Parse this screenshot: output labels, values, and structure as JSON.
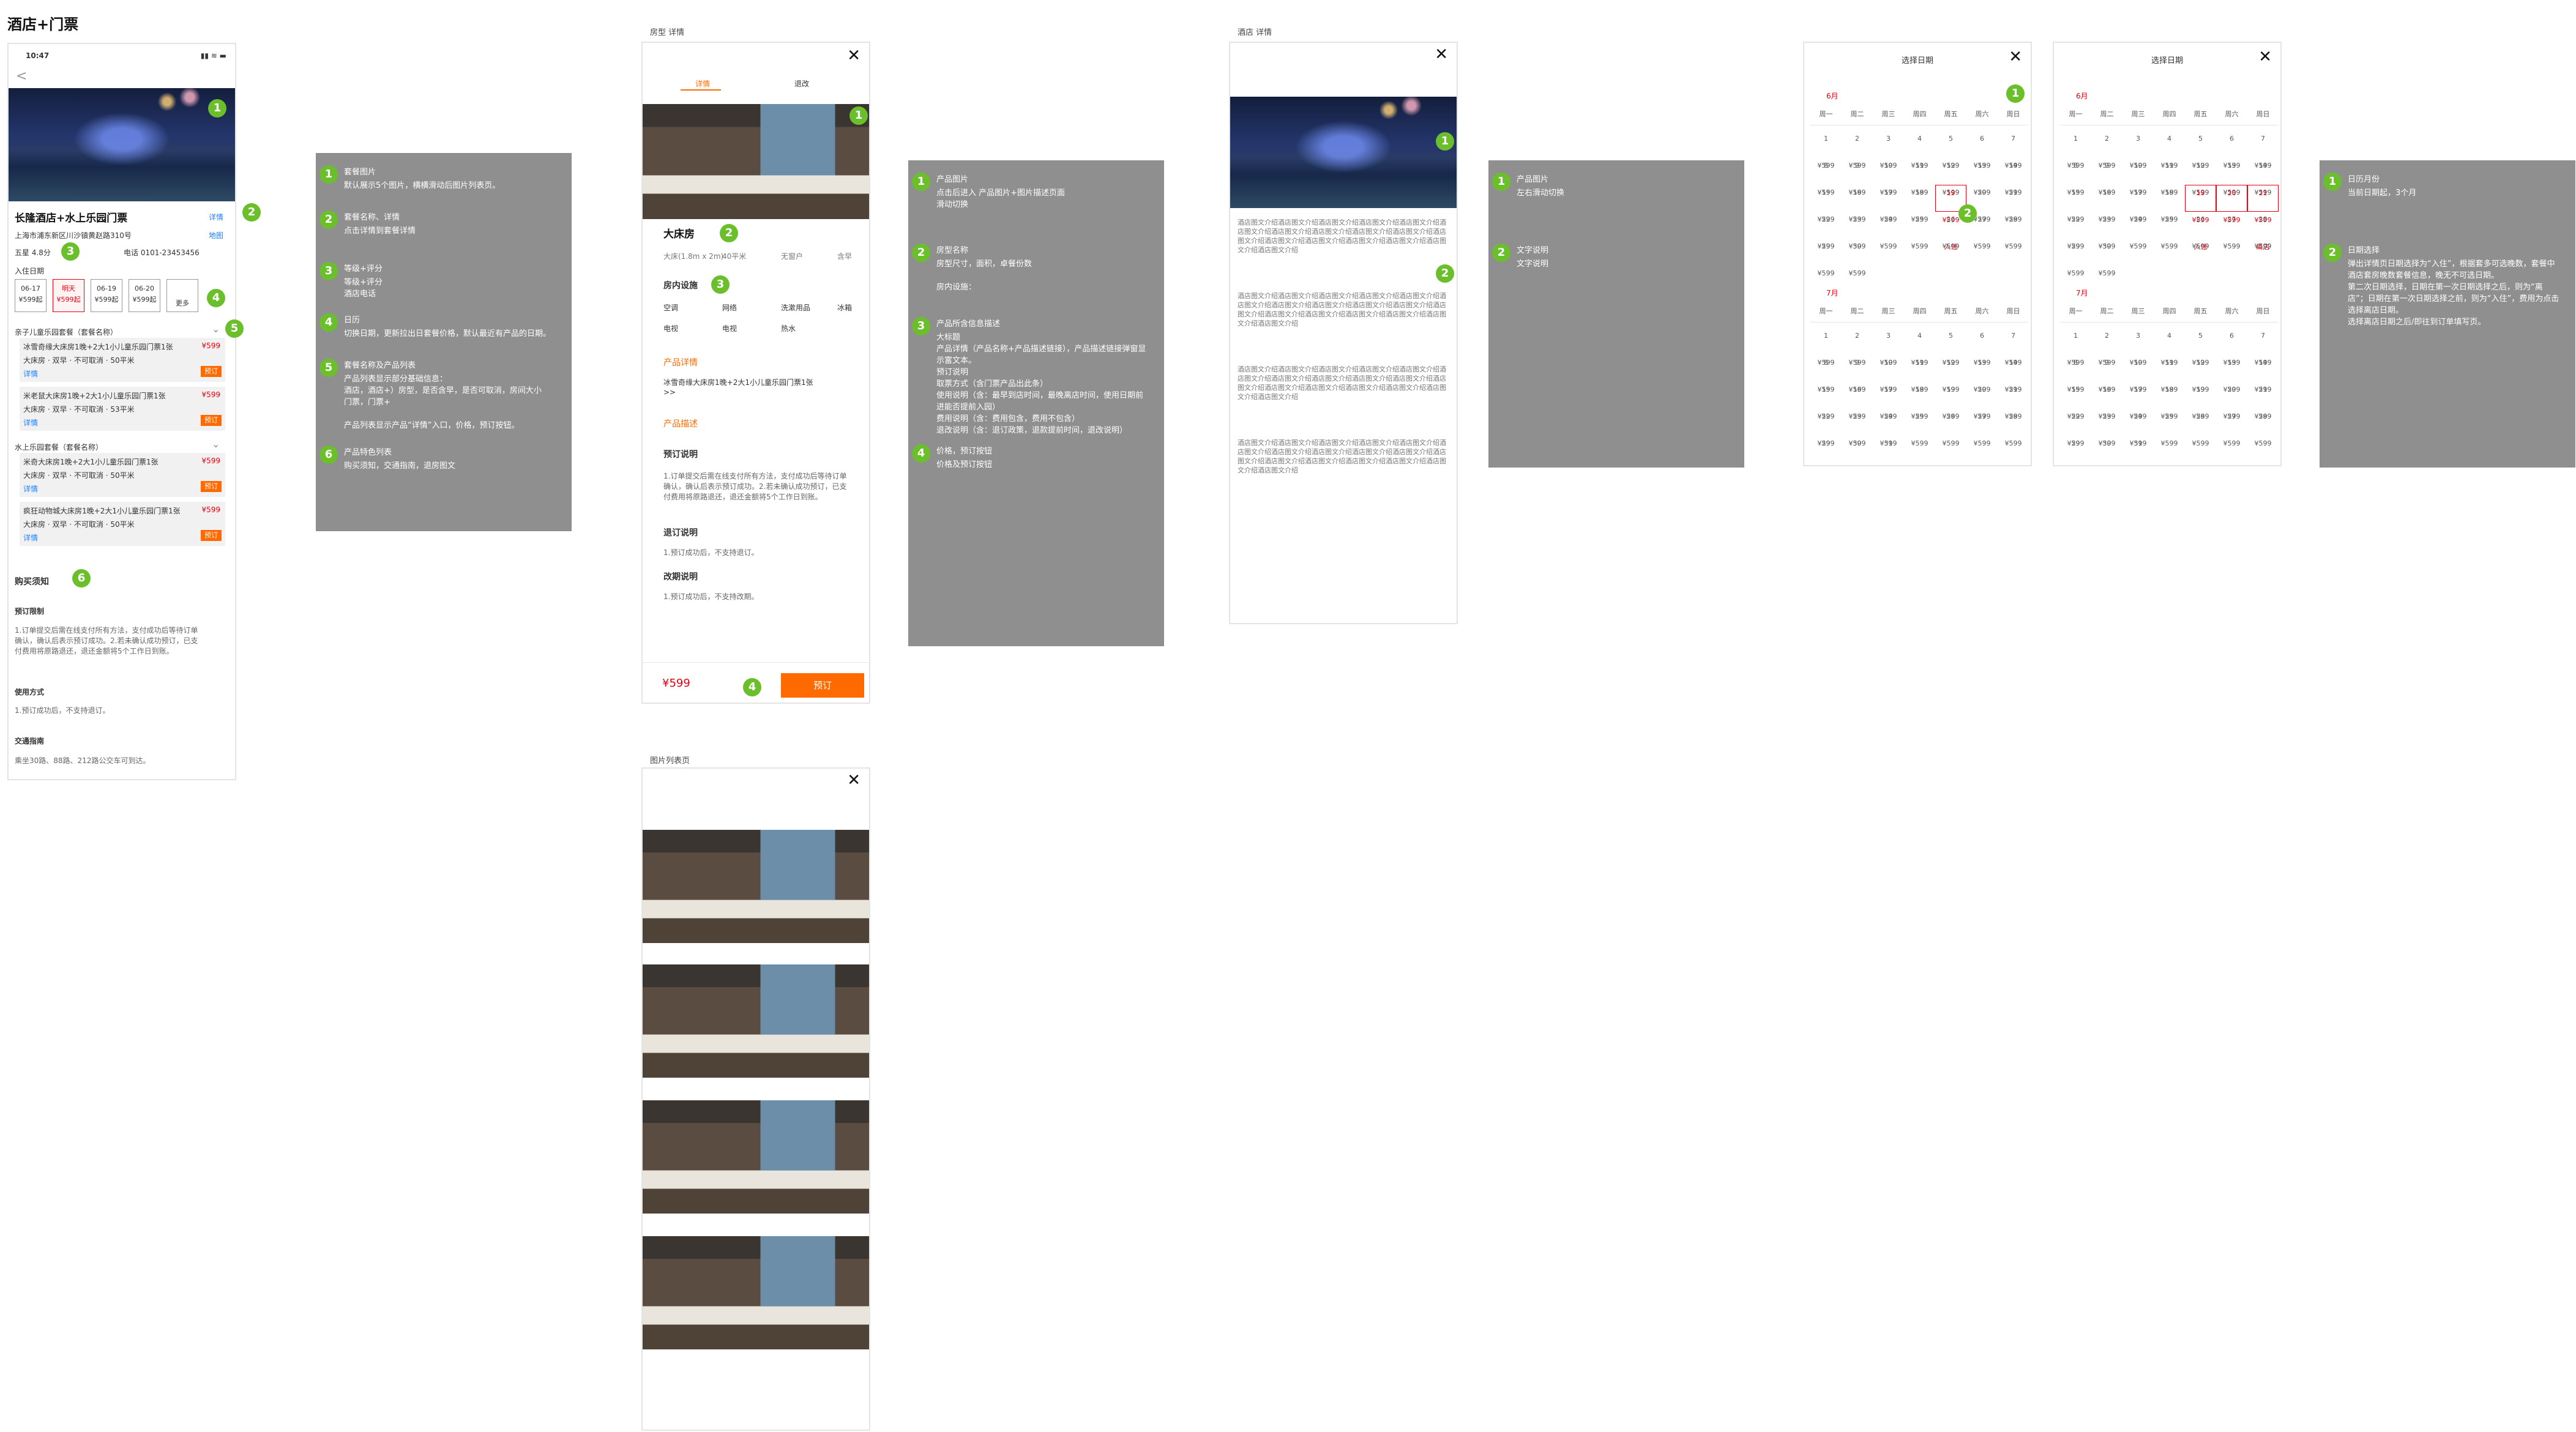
{
  "page_title": "酒店+门票",
  "frame1": {
    "time": "10:47",
    "back": "<",
    "hotel_name": "长隆酒店+水上乐园门票",
    "detail_link": "详情",
    "address": "上海市浦东新区川沙镇黄赵路310号",
    "map_link": "地图",
    "level_rating": "五星 4.8分",
    "phone": "电话 0101-23453456",
    "checkin_label": "入住日期",
    "date_chips": [
      {
        "d": "06-17",
        "p": "¥599起"
      },
      {
        "d": "明天",
        "p": "¥599起"
      },
      {
        "d": "06-19",
        "p": "¥599起"
      },
      {
        "d": "06-20",
        "p": "¥599起"
      },
      {
        "d": "更多",
        "p": ""
      }
    ],
    "group1": "亲子儿童乐园套餐（套餐名称）",
    "group2": "水上乐园套餐（套餐名称）",
    "rooms": [
      {
        "t": "冰雪奇缘大床房1晚+2大1小儿童乐园门票1张",
        "s": "大床房 · 双早 · 不可取消 · 50平米",
        "link": "详情",
        "price": "¥599",
        "btn": "预订"
      },
      {
        "t": "米老鼠大床房1晚+2大1小儿童乐园门票1张",
        "s": "大床房 · 双早 · 不可取消 · 53平米",
        "link": "详情",
        "price": "¥599",
        "btn": "预订"
      },
      {
        "t": "米奇大床房1晚+2大1小儿童乐园门票1张",
        "s": "大床房 · 双早 · 不可取消 · 50平米",
        "link": "详情",
        "price": "¥599",
        "btn": "预订"
      },
      {
        "t": "疯狂动物城大床房1晚+2大1小儿童乐园门票1张",
        "s": "大床房 · 双早 · 不可取消 · 50平米",
        "link": "详情",
        "price": "¥599",
        "btn": "预订"
      }
    ],
    "notice_title": "购买须知",
    "booking_limit_title": "预订限制",
    "booking_limit_text": "1.订单提交后需在线支付所有方法，支付成功后等待订单确认，确认后表示预订成功。2.若未确认成功预订，已支付费用将原路退还，退还金额将5个工作日到账。",
    "use_title": "使用方式",
    "use_text": "1.预订成功后，不支持退订。",
    "traffic_title": "交通指南",
    "traffic_text": "乘坐30路、88路、212路公交车可到达。"
  },
  "note1": {
    "items": [
      {
        "n": "1",
        "t": "套餐图片",
        "d": "默认展示5个图片，横横滑动后图片列表页。"
      },
      {
        "n": "2",
        "t": "套餐名称、详情",
        "d": "点击详情到套餐详情"
      },
      {
        "n": "3",
        "t": "等级+评分",
        "d": "等级+评分\n酒店电话"
      },
      {
        "n": "4",
        "t": "日历",
        "d": "切换日期，更新拉出日套餐价格，默认最近有产品的日期。"
      },
      {
        "n": "5",
        "t": "套餐名称及产品列表",
        "d": "产品列表显示部分基础信息：\n酒店，酒店+）房型，是否含早，是否可取消，房间大小\n门票，门票+\n\n产品列表显示产品“详情”入口，价格，预订按钮。"
      },
      {
        "n": "6",
        "t": "产品特色列表",
        "d": "购买须知，交通指南，退房图文"
      }
    ]
  },
  "frame2": {
    "label": "房型 详情",
    "tab1": "详情",
    "tab2": "退改",
    "room_title": "大床房",
    "room_specs": [
      "大床(1.8m x 2m)",
      "40平米",
      "无窗户",
      "含早"
    ],
    "facility_title": "房内设施",
    "facilities": [
      "空调",
      "网络",
      "洗漱用品",
      "冰箱",
      "电视",
      "电视",
      "热水"
    ],
    "product_detail_title": "产品详情",
    "product_detail_text": "冰雪奇缘大床房1晚+2大1小儿童乐园门票1张",
    "product_detail_more": ">>",
    "product_desc_title": "产品描述",
    "booking_title": "预订说明",
    "booking_text": "1.订单提交后需在线支付所有方法，支付成功后等待订单确认，确认后表示预订成功。2.若未确认成功预订，已支付费用将原路退还，退还金额将5个工作日到账。",
    "refund_title": "退订说明",
    "refund_text": "1.预订成功后，不支持退订。",
    "change_title": "改期说明",
    "change_text": "1.预订成功后，不支持改期。",
    "price": "¥599",
    "book_btn": "预订"
  },
  "frame3": {
    "label": "图片列表页"
  },
  "note2": {
    "items": [
      {
        "n": "1",
        "t": "产品图片",
        "d": "点击后进入 产品图片+图片描述页面\n滑动切换"
      },
      {
        "n": "2",
        "t": "房型名称",
        "d": "房型尺寸，面积，卓餐份数\n\n房内设施："
      },
      {
        "n": "3",
        "t": "产品所含信息描述",
        "d": "大标题\n产品详情（产品名称+产品描述链接），产品描述链接弹窗显示富文本。\n预订说明\n取票方式（含门票产品出此条）\n使用说明（含：最早到店时间，最晚离店时间，使用日期前进能否提前入园）\n费用说明（含：费用包含，费用不包含）\n退改说明（含：退订政策，退款提前时间，退改说明）"
      },
      {
        "n": "4",
        "t": "价格，预订按钮",
        "d": "价格及预订按钮"
      }
    ]
  },
  "frame4": {
    "label": "酒店 详情",
    "paragraph": "酒店图文介绍酒店图文介绍酒店图文介绍酒店图文介绍酒店图文介绍酒店图文介绍酒店图文介绍酒店图文介绍酒店图文介绍酒店图文介绍酒店图文介绍酒店图文介绍酒店图文介绍酒店图文介绍酒店图文介绍酒店图文介绍酒店图文介绍"
  },
  "note3": {
    "items": [
      {
        "n": "1",
        "t": "产品图片",
        "d": "左右滑动切换"
      },
      {
        "n": "2",
        "t": "文字说明",
        "d": "文字说明"
      }
    ]
  },
  "calendar": {
    "title": "选择日期",
    "weekdays": [
      "周一",
      "周二",
      "周三",
      "周四",
      "周五",
      "周六",
      "周日"
    ],
    "month1": "6月",
    "month2": "7月",
    "price": "¥599",
    "checkin_tag": "入住",
    "checkout_tag": "离店"
  },
  "note4": {
    "items": [
      {
        "n": "1",
        "t": "日历月份",
        "d": "当前日期起，3个月"
      },
      {
        "n": "2",
        "t": "日期选择",
        "d": "弹出详情页日期选择为“入住”，根据套多可选晚数，套餐中酒店套房晚数套餐信息，晚无不可选日期。\n第二次日期选择，日期在第一次日期选择之后，则为“离店”；日期在第一次日期选择之前，则为“入住”，费用为点击选择离店日期。\n选择离店日期之后/即往到订单填写页。"
      }
    ]
  },
  "colors": {
    "badge": "#6bbf2a",
    "note_bg": "#8f8f8f",
    "accent": "#ff6a00",
    "red": "#e60012",
    "link": "#1e7fff"
  }
}
